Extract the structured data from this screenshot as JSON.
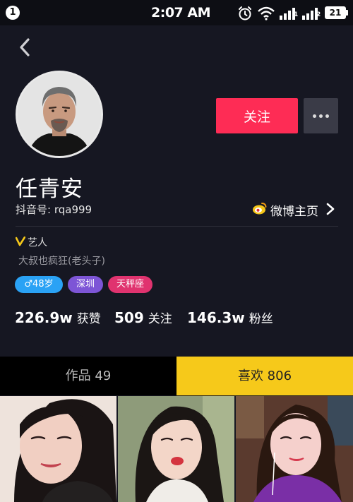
{
  "status_bar": {
    "notification_count": "1",
    "time": "2:07 AM",
    "sim1_label": "1",
    "sim2_label": "2",
    "battery": "21"
  },
  "profile": {
    "name": "任青安",
    "douyin_id": "抖音号: rqa999",
    "follow_label": "关注",
    "weibo_label": "微博主页",
    "verified_label": "艺人",
    "bio": "大叔也疯狂(老头子)",
    "tags": {
      "age": "♂48岁",
      "city": "深圳",
      "zodiac": "天秤座"
    },
    "stats": {
      "likes_count": "226.9w",
      "likes_label": "获赞",
      "following_count": "509",
      "following_label": "关注",
      "followers_count": "146.3w",
      "followers_label": "粉丝"
    }
  },
  "tabs": {
    "works": "作品 49",
    "likes": "喜欢 806",
    "active": "likes"
  },
  "icons": {
    "back": "chevron-left-icon",
    "more": "more-dots-icon",
    "weibo": "weibo-icon",
    "weibo_chevron": "chevron-right-icon",
    "verified": "verified-v-icon",
    "alarm": "alarm-icon",
    "wifi": "wifi-icon",
    "signal": "signal-icon"
  },
  "colors": {
    "background": "#161722",
    "follow_button": "#fe2c55",
    "active_tab": "#f6c91a",
    "verified": "#f6c91a",
    "tag_age": "#2aa2f5",
    "tag_city": "#7d55d6",
    "tag_zodiac": "#e0336f"
  }
}
